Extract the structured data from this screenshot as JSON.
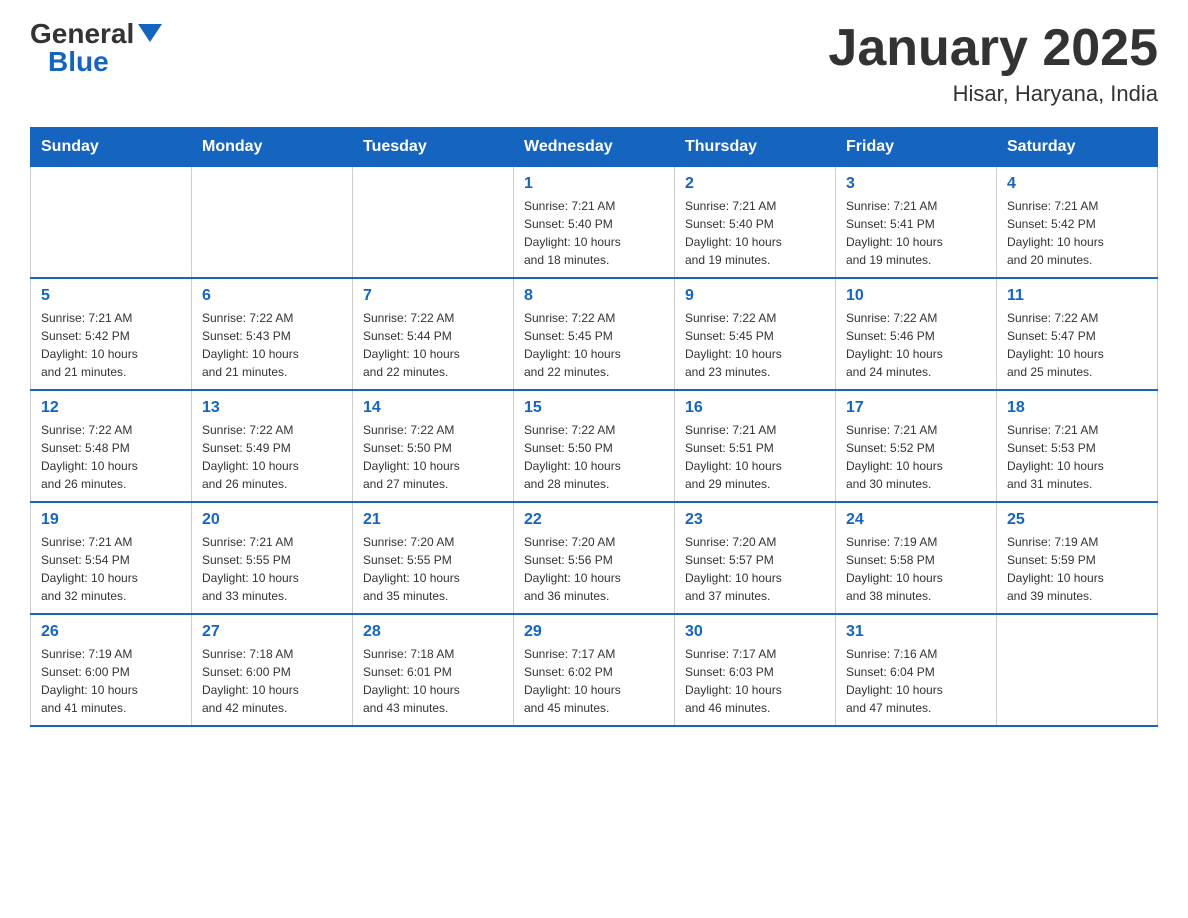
{
  "header": {
    "logo_general": "General",
    "logo_blue": "Blue",
    "title": "January 2025",
    "subtitle": "Hisar, Haryana, India"
  },
  "days_of_week": [
    "Sunday",
    "Monday",
    "Tuesday",
    "Wednesday",
    "Thursday",
    "Friday",
    "Saturday"
  ],
  "weeks": [
    [
      {
        "day": "",
        "info": ""
      },
      {
        "day": "",
        "info": ""
      },
      {
        "day": "",
        "info": ""
      },
      {
        "day": "1",
        "info": "Sunrise: 7:21 AM\nSunset: 5:40 PM\nDaylight: 10 hours\nand 18 minutes."
      },
      {
        "day": "2",
        "info": "Sunrise: 7:21 AM\nSunset: 5:40 PM\nDaylight: 10 hours\nand 19 minutes."
      },
      {
        "day": "3",
        "info": "Sunrise: 7:21 AM\nSunset: 5:41 PM\nDaylight: 10 hours\nand 19 minutes."
      },
      {
        "day": "4",
        "info": "Sunrise: 7:21 AM\nSunset: 5:42 PM\nDaylight: 10 hours\nand 20 minutes."
      }
    ],
    [
      {
        "day": "5",
        "info": "Sunrise: 7:21 AM\nSunset: 5:42 PM\nDaylight: 10 hours\nand 21 minutes."
      },
      {
        "day": "6",
        "info": "Sunrise: 7:22 AM\nSunset: 5:43 PM\nDaylight: 10 hours\nand 21 minutes."
      },
      {
        "day": "7",
        "info": "Sunrise: 7:22 AM\nSunset: 5:44 PM\nDaylight: 10 hours\nand 22 minutes."
      },
      {
        "day": "8",
        "info": "Sunrise: 7:22 AM\nSunset: 5:45 PM\nDaylight: 10 hours\nand 22 minutes."
      },
      {
        "day": "9",
        "info": "Sunrise: 7:22 AM\nSunset: 5:45 PM\nDaylight: 10 hours\nand 23 minutes."
      },
      {
        "day": "10",
        "info": "Sunrise: 7:22 AM\nSunset: 5:46 PM\nDaylight: 10 hours\nand 24 minutes."
      },
      {
        "day": "11",
        "info": "Sunrise: 7:22 AM\nSunset: 5:47 PM\nDaylight: 10 hours\nand 25 minutes."
      }
    ],
    [
      {
        "day": "12",
        "info": "Sunrise: 7:22 AM\nSunset: 5:48 PM\nDaylight: 10 hours\nand 26 minutes."
      },
      {
        "day": "13",
        "info": "Sunrise: 7:22 AM\nSunset: 5:49 PM\nDaylight: 10 hours\nand 26 minutes."
      },
      {
        "day": "14",
        "info": "Sunrise: 7:22 AM\nSunset: 5:50 PM\nDaylight: 10 hours\nand 27 minutes."
      },
      {
        "day": "15",
        "info": "Sunrise: 7:22 AM\nSunset: 5:50 PM\nDaylight: 10 hours\nand 28 minutes."
      },
      {
        "day": "16",
        "info": "Sunrise: 7:21 AM\nSunset: 5:51 PM\nDaylight: 10 hours\nand 29 minutes."
      },
      {
        "day": "17",
        "info": "Sunrise: 7:21 AM\nSunset: 5:52 PM\nDaylight: 10 hours\nand 30 minutes."
      },
      {
        "day": "18",
        "info": "Sunrise: 7:21 AM\nSunset: 5:53 PM\nDaylight: 10 hours\nand 31 minutes."
      }
    ],
    [
      {
        "day": "19",
        "info": "Sunrise: 7:21 AM\nSunset: 5:54 PM\nDaylight: 10 hours\nand 32 minutes."
      },
      {
        "day": "20",
        "info": "Sunrise: 7:21 AM\nSunset: 5:55 PM\nDaylight: 10 hours\nand 33 minutes."
      },
      {
        "day": "21",
        "info": "Sunrise: 7:20 AM\nSunset: 5:55 PM\nDaylight: 10 hours\nand 35 minutes."
      },
      {
        "day": "22",
        "info": "Sunrise: 7:20 AM\nSunset: 5:56 PM\nDaylight: 10 hours\nand 36 minutes."
      },
      {
        "day": "23",
        "info": "Sunrise: 7:20 AM\nSunset: 5:57 PM\nDaylight: 10 hours\nand 37 minutes."
      },
      {
        "day": "24",
        "info": "Sunrise: 7:19 AM\nSunset: 5:58 PM\nDaylight: 10 hours\nand 38 minutes."
      },
      {
        "day": "25",
        "info": "Sunrise: 7:19 AM\nSunset: 5:59 PM\nDaylight: 10 hours\nand 39 minutes."
      }
    ],
    [
      {
        "day": "26",
        "info": "Sunrise: 7:19 AM\nSunset: 6:00 PM\nDaylight: 10 hours\nand 41 minutes."
      },
      {
        "day": "27",
        "info": "Sunrise: 7:18 AM\nSunset: 6:00 PM\nDaylight: 10 hours\nand 42 minutes."
      },
      {
        "day": "28",
        "info": "Sunrise: 7:18 AM\nSunset: 6:01 PM\nDaylight: 10 hours\nand 43 minutes."
      },
      {
        "day": "29",
        "info": "Sunrise: 7:17 AM\nSunset: 6:02 PM\nDaylight: 10 hours\nand 45 minutes."
      },
      {
        "day": "30",
        "info": "Sunrise: 7:17 AM\nSunset: 6:03 PM\nDaylight: 10 hours\nand 46 minutes."
      },
      {
        "day": "31",
        "info": "Sunrise: 7:16 AM\nSunset: 6:04 PM\nDaylight: 10 hours\nand 47 minutes."
      },
      {
        "day": "",
        "info": ""
      }
    ]
  ]
}
